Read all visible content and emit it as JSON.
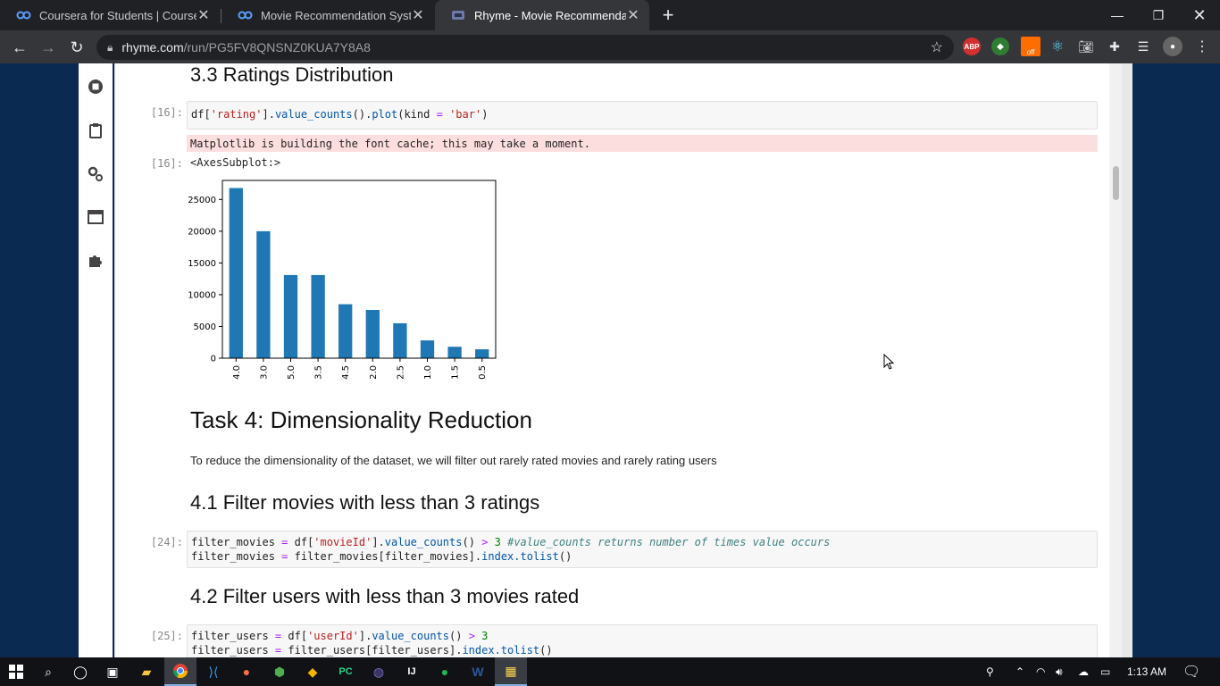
{
  "browser": {
    "tabs": [
      {
        "title": "Coursera for Students | Coursera",
        "active": false
      },
      {
        "title": "Movie Recommendation System",
        "active": false
      },
      {
        "title": "Rhyme - Movie Recommendation",
        "active": true
      }
    ],
    "url_host": "rhyme.com",
    "url_path": "/run/PG5FV8QNSNZ0KUA7Y8A8",
    "ext_abp": "ABP",
    "ext_off": "off"
  },
  "notebook": {
    "section_33": "3.3 Ratings Distribution",
    "cell16_prompt": "[16]:",
    "cell16_code": {
      "p1": "df[",
      "s1": "'rating'",
      "p2": "].",
      "f1": "value_counts",
      "p3": "().",
      "f2": "plot",
      "p4": "(kind ",
      "o1": "=",
      "p5": " ",
      "s2": "'bar'",
      "p6": ")"
    },
    "stderr": "Matplotlib is building the font cache; this may take a moment.",
    "out16_prompt": "[16]:",
    "out16_text": "<AxesSubplot:>",
    "task4_title": "Task 4: Dimensionality Reduction",
    "task4_desc": "To reduce the dimensionality of the dataset, we will filter out rarely rated movies and rarely rating users",
    "section_41": "4.1 Filter movies with less than 3 ratings",
    "cell24_prompt": "[24]:",
    "cell24": {
      "l1a": "filter_movies ",
      "l1o": "=",
      "l1b": " df[",
      "l1s": "'movieId'",
      "l1c": "].",
      "l1f": "value_counts",
      "l1d": "() ",
      "l1o2": ">",
      "l1e": " ",
      "l1n": "3",
      "l1g": " ",
      "l1cm": "#value_counts returns number of times value occurs",
      "l2a": "filter_movies ",
      "l2o": "=",
      "l2b": " filter_movies[filter_movies].",
      "l2f": "index.tolist",
      "l2c": "()"
    },
    "section_42": "4.2 Filter users with less than 3 movies rated",
    "cell25_prompt": "[25]:",
    "cell25": {
      "l1a": "filter_users ",
      "l1o": "=",
      "l1b": " df[",
      "l1s": "'userId'",
      "l1c": "].",
      "l1f": "value_counts",
      "l1d": "() ",
      "l1o2": ">",
      "l1e": " ",
      "l1n": "3",
      "l2a": "filter_users ",
      "l2o": "=",
      "l2b": " filter_users[filter_users].",
      "l2f": "index.tolist",
      "l2c": "()"
    }
  },
  "chart_data": {
    "type": "bar",
    "categories": [
      "4.0",
      "3.0",
      "5.0",
      "3.5",
      "4.5",
      "2.0",
      "2.5",
      "1.0",
      "1.5",
      "0.5"
    ],
    "values": [
      26800,
      20000,
      13100,
      13100,
      8500,
      7600,
      5500,
      2800,
      1800,
      1400
    ],
    "yticks": [
      0,
      5000,
      10000,
      15000,
      20000,
      25000
    ],
    "ylim": [
      0,
      28000
    ],
    "color": "#1f77b4",
    "title": "",
    "xlabel": "",
    "ylabel": ""
  },
  "taskbar": {
    "time": "1:13 AM"
  }
}
